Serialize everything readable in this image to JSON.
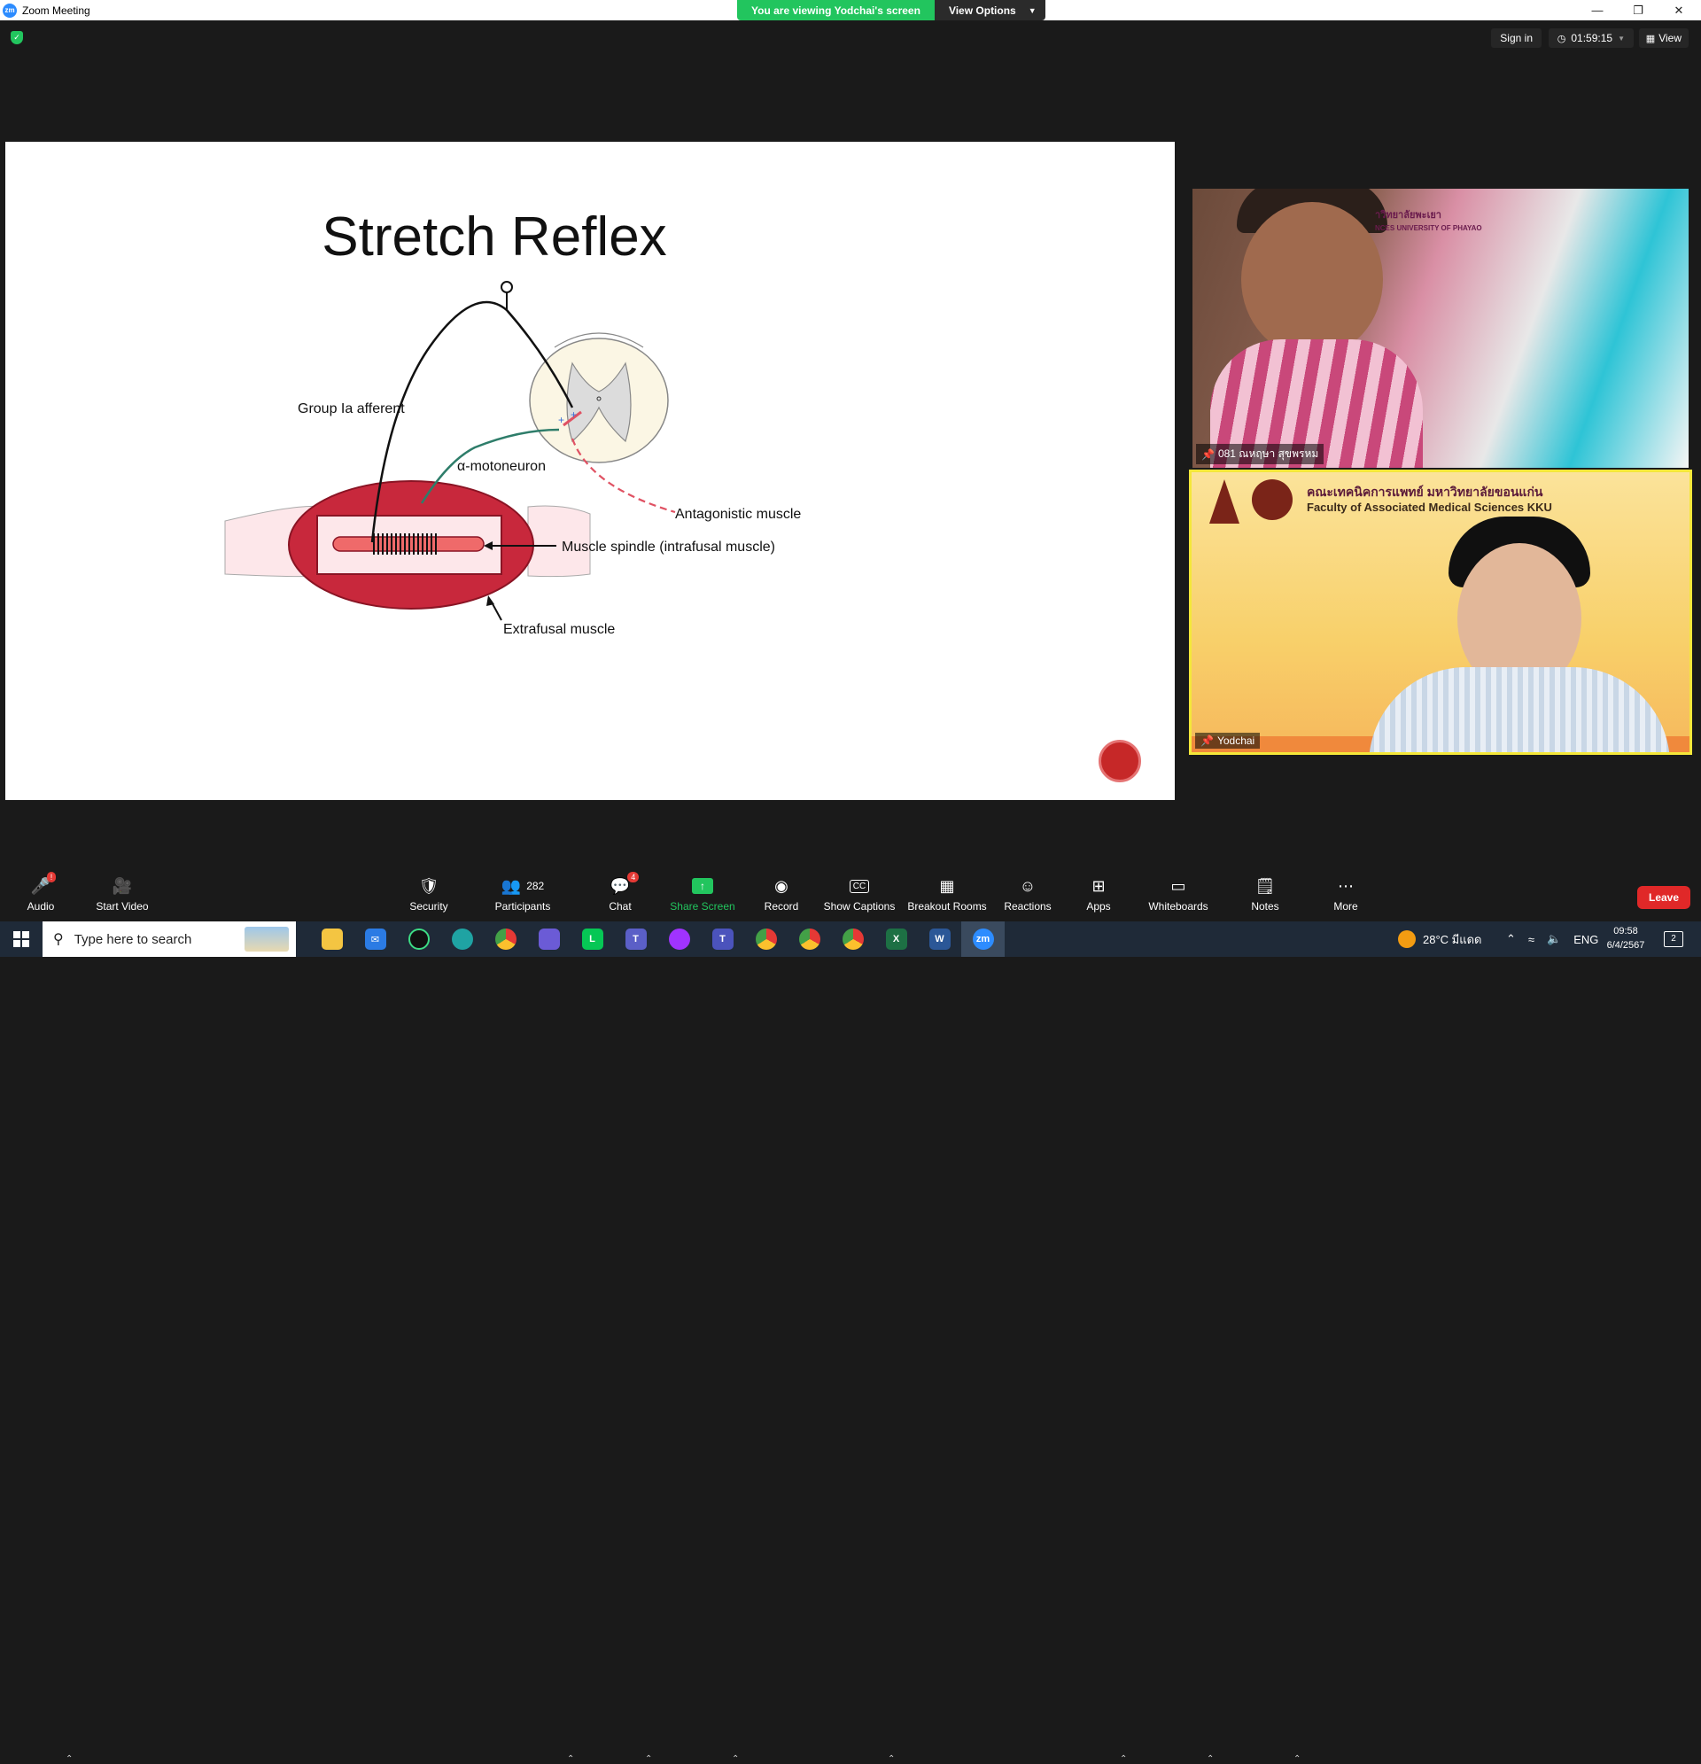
{
  "window": {
    "title": "Zoom Meeting",
    "app_icon_text": "zm"
  },
  "banner": {
    "viewing_text": "You are viewing Yodchai's screen",
    "view_options": "View Options"
  },
  "topbar": {
    "sign_in": "Sign in",
    "timer": "01:59:15",
    "view": "View"
  },
  "slide": {
    "title": "Stretch Reflex",
    "labels": {
      "afferent": "Group Ia afferent",
      "motoneuron": "α-motoneuron",
      "antagonistic": "Antagonistic muscle",
      "spindle": "Muscle spindle (intrafusal muscle)",
      "extrafusal": "Extrafusal muscle"
    }
  },
  "videos": [
    {
      "name": "081 ณหฤษา สุขพรหม",
      "bg_text_thai": "าวิทยาลัยพะเยา",
      "bg_text_en": "NCES UNIVERSITY OF PHAYAO"
    },
    {
      "name": "Yodchai",
      "faculty_thai": "คณะเทคนิคการแพทย์ มหาวิทยาลัยขอนแก่น",
      "faculty_en": "Faculty of Associated Medical Sciences KKU"
    }
  ],
  "toolbar": {
    "audio": "Audio",
    "start_video": "Start Video",
    "security": "Security",
    "participants": "Participants",
    "participants_count": "282",
    "chat": "Chat",
    "chat_badge": "4",
    "share_screen": "Share Screen",
    "record": "Record",
    "show_captions": "Show Captions",
    "breakout_rooms": "Breakout Rooms",
    "reactions": "Reactions",
    "apps": "Apps",
    "whiteboards": "Whiteboards",
    "notes": "Notes",
    "more": "More",
    "leave": "Leave"
  },
  "taskbar": {
    "search_placeholder": "Type here to search",
    "weather": "28°C มีแดด",
    "language": "ENG",
    "time": "09:58",
    "date": "6/4/2567",
    "notification_count": "2"
  },
  "colors": {
    "accent_green": "#22c55e",
    "leave_red": "#e02828",
    "muscle_red": "#c8283c",
    "zoom_blue": "#2d8cff"
  }
}
